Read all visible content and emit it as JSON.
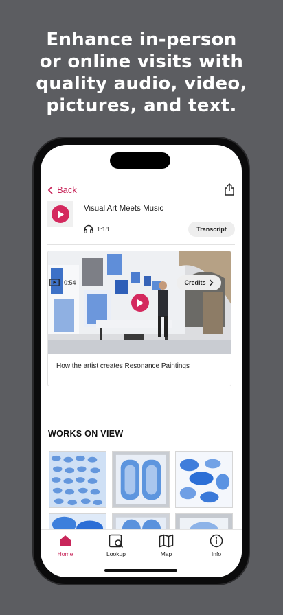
{
  "promo": {
    "line1": "Enhance in-person",
    "line2": "or online visits with",
    "line3": "quality audio, video,",
    "line4": "pictures, and text."
  },
  "nav": {
    "back_label": "Back"
  },
  "audio": {
    "title": "Visual Art Meets Music",
    "duration": "1:18",
    "transcript_label": "Transcript"
  },
  "video": {
    "title": "How the artist creates Resonance Paintings",
    "duration": "0:54",
    "credits_label": "Credits"
  },
  "works": {
    "title": "WORKS ON VIEW"
  },
  "tabs": [
    {
      "label": "Home",
      "icon": "home-icon",
      "active": true
    },
    {
      "label": "Lookup",
      "icon": "lookup-icon",
      "active": false
    },
    {
      "label": "Map",
      "icon": "map-icon",
      "active": false
    },
    {
      "label": "Info",
      "icon": "info-icon",
      "active": false
    }
  ],
  "colors": {
    "accent": "#c8265a",
    "play": "#d4295e",
    "background": "#5c5d61"
  }
}
